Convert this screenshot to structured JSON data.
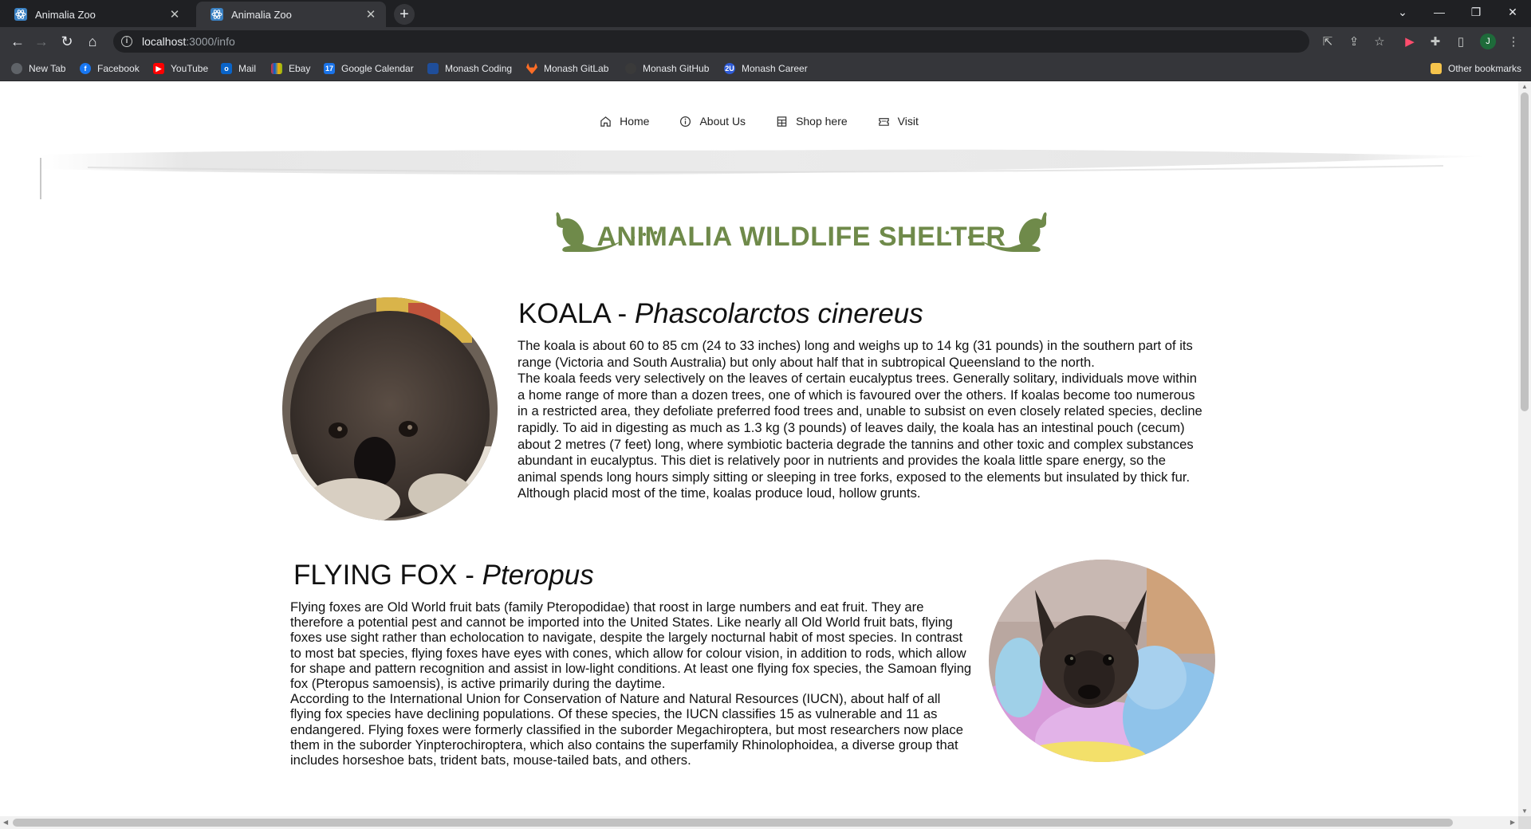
{
  "browser": {
    "tabs": [
      {
        "title": "Animalia Zoo",
        "active": false
      },
      {
        "title": "Animalia Zoo",
        "active": true
      }
    ],
    "url_host": "localhost",
    "url_path": ":3000/info",
    "profile_initial": "J",
    "bookmarks": [
      {
        "label": "New Tab",
        "icon": "globe-icon",
        "color": "#5f6368"
      },
      {
        "label": "Facebook",
        "icon": "facebook-icon",
        "color": "#1877f2"
      },
      {
        "label": "YouTube",
        "icon": "youtube-icon",
        "color": "#ff0000"
      },
      {
        "label": "Mail",
        "icon": "outlook-icon",
        "color": "#0a64c8"
      },
      {
        "label": "Ebay",
        "icon": "ebay-icon",
        "color": "#e53238"
      },
      {
        "label": "Google Calendar",
        "icon": "calendar-icon",
        "color": "#1a73e8"
      },
      {
        "label": "Monash Coding",
        "icon": "monash-icon",
        "color": "#1f4e9a"
      },
      {
        "label": "Monash  GitLab",
        "icon": "gitlab-icon",
        "color": "#fc6d26"
      },
      {
        "label": "Monash GitHub",
        "icon": "github-icon",
        "color": "#3a3a3a"
      },
      {
        "label": "Monash Career",
        "icon": "monash-career-icon",
        "color": "#2e5bd6"
      }
    ],
    "other_bookmarks": "Other bookmarks"
  },
  "nav": {
    "home": "Home",
    "about": "About Us",
    "shop": "Shop here",
    "visit": "Visit"
  },
  "banner": {
    "title": "ANIMALIA WILDLIFE SHELTER",
    "color": "#6f8a4a"
  },
  "animals": [
    {
      "name": "KOALA",
      "separator": " - ",
      "scientific": "Phascolarctos cinereus",
      "paragraphs": [
        "The koala is about 60 to 85 cm (24 to 33 inches) long and weighs up to 14 kg (31 pounds) in the southern part of its range (Victoria and South Australia) but only about half that in subtropical Queensland to the north.",
        "The koala feeds very selectively on the leaves of certain eucalyptus trees. Generally solitary, individuals move within a home range of more than a dozen trees, one of which is favoured over the others. If koalas become too numerous in a restricted area, they defoliate preferred food trees and, unable to subsist on even closely related species, decline rapidly. To aid in digesting as much as 1.3 kg (3 pounds) of leaves daily, the koala has an intestinal pouch (cecum) about 2 metres (7 feet) long, where symbiotic bacteria degrade the tannins and other toxic and complex substances abundant in eucalyptus. This diet is relatively poor in nutrients and provides the koala little spare energy, so the animal spends long hours simply sitting or sleeping in tree forks, exposed to the elements but insulated by thick fur. Although placid most of the time, koalas produce loud, hollow grunts."
      ]
    },
    {
      "name": "FLYING FOX",
      "separator": " - ",
      "scientific": "Pteropus",
      "paragraphs": [
        "Flying foxes are Old World fruit bats (family Pteropodidae) that roost in large numbers and eat fruit. They are therefore a potential pest and cannot be imported into the United States. Like nearly all Old World fruit bats, flying foxes use sight rather than echolocation to navigate, despite the largely nocturnal habit of most species. In contrast to most bat species, flying foxes have eyes with cones, which allow for colour vision, in addition to rods, which allow for shape and pattern recognition and assist in low-light conditions. At least one flying fox species, the Samoan flying fox (Pteropus samoensis), is active primarily during the daytime.",
        "According to the International Union for Conservation of Nature and Natural Resources (IUCN), about half of all flying fox species have declining populations. Of these species, the IUCN classifies 15 as vulnerable and 11 as endangered. Flying foxes were formerly classified in the suborder Megachiroptera, but most researchers now place them in the suborder Yinpterochiroptera, which also contains the superfamily Rhinolophoidea, a diverse group that includes horseshoe bats, trident bats, mouse-tailed bats, and others."
      ]
    }
  ]
}
